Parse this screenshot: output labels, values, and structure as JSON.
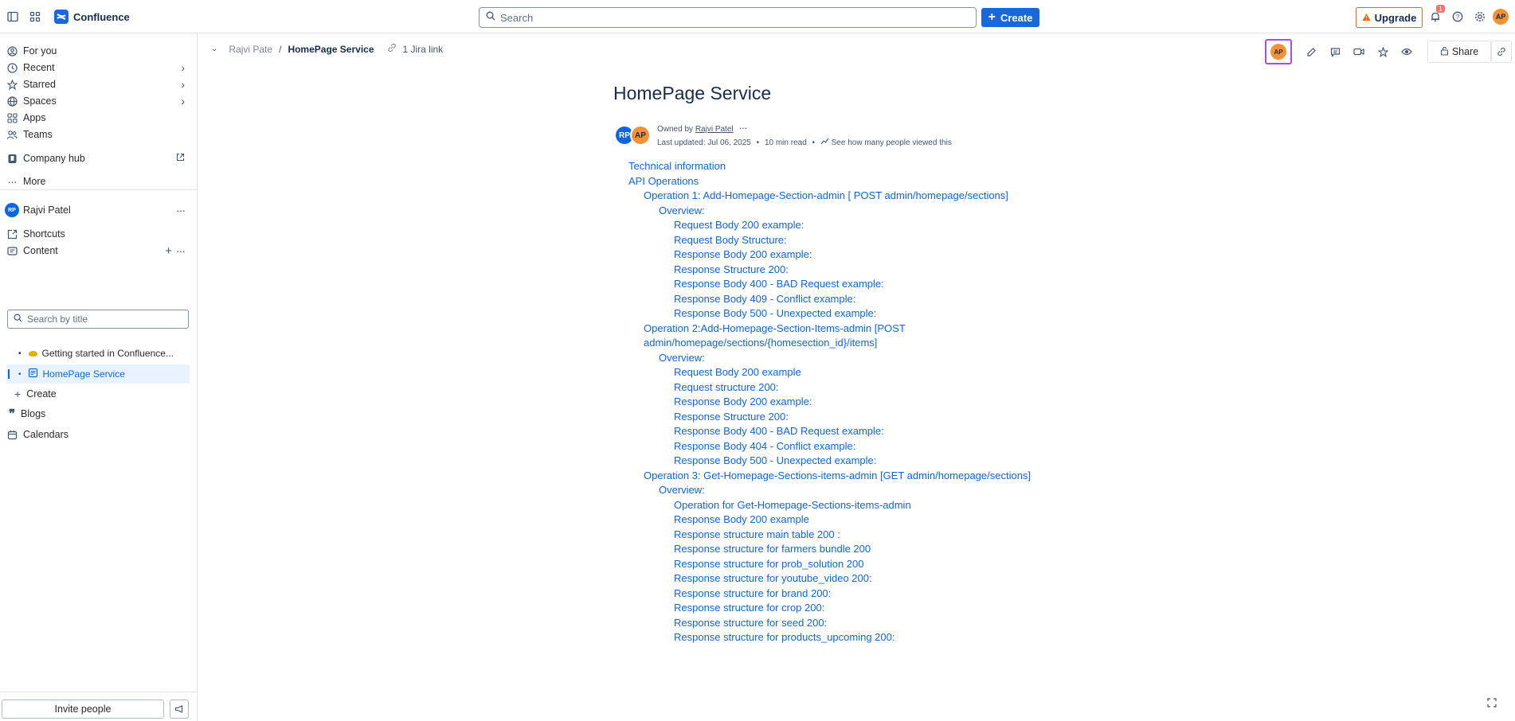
{
  "topbar": {
    "app_name": "Confluence",
    "search_placeholder": "Search",
    "create_label": "Create",
    "upgrade_label": "Upgrade",
    "notification_count": "1",
    "user_initials": "AP"
  },
  "sidebar": {
    "nav": [
      {
        "label": "For you",
        "icon": "person-circle-icon"
      },
      {
        "label": "Recent",
        "icon": "clock-icon"
      },
      {
        "label": "Starred",
        "icon": "star-icon"
      },
      {
        "label": "Spaces",
        "icon": "globe-icon"
      },
      {
        "label": "Apps",
        "icon": "apps-icon"
      },
      {
        "label": "Teams",
        "icon": "people-icon"
      }
    ],
    "company_hub": "Company hub",
    "more": "More",
    "space_initials": "RP",
    "space_name": "Rajvi Patel",
    "shortcuts": "Shortcuts",
    "content": "Content",
    "search_placeholder": "Search by title",
    "tree": [
      {
        "label": "Getting started in Confluence..."
      },
      {
        "label": "HomePage Service"
      }
    ],
    "create": "Create",
    "blogs": "Blogs",
    "calendars": "Calendars",
    "invite": "Invite people"
  },
  "breadcrumb": {
    "parent": "Rajvi Pate",
    "separator": "/",
    "current": "HomePage Service",
    "jira_link": "1 Jira link"
  },
  "page_actions": {
    "avatar_initials": "AP",
    "share_label": "Share"
  },
  "page": {
    "title": "HomePage Service",
    "author_initials_1": "RP",
    "author_initials_2": "AP",
    "owned_by_prefix": "Owned by",
    "owner": "Rajvi Patel",
    "last_updated": "Last updated: Jul 06, 2025",
    "read_time": "10 min read",
    "views_link": "See how many people viewed this",
    "dot": "•"
  },
  "toc": [
    {
      "level": 1,
      "text": "Technical information"
    },
    {
      "level": 1,
      "text": "API Operations"
    },
    {
      "level": 2,
      "text": "Operation 1: Add-Homepage-Section-admin [ POST admin/homepage/sections]"
    },
    {
      "level": 3,
      "text": "Overview:"
    },
    {
      "level": 4,
      "text": "Request Body 200 example:"
    },
    {
      "level": 4,
      "text": "Request Body Structure:"
    },
    {
      "level": 4,
      "text": "Response Body 200 example:"
    },
    {
      "level": 4,
      "text": "Response Structure 200:"
    },
    {
      "level": 4,
      "text": "Response Body 400 - BAD Request example:"
    },
    {
      "level": 4,
      "text": "Response Body 409 - Conflict example:"
    },
    {
      "level": 4,
      "text": "Response Body 500 - Unexpected example:"
    },
    {
      "level": 2,
      "text": "Operation 2:Add-Homepage-Section-Items-admin [POST admin/homepage/sections/{homesection_id}/items]"
    },
    {
      "level": 3,
      "text": "Overview:"
    },
    {
      "level": 4,
      "text": "Request Body 200 example"
    },
    {
      "level": 4,
      "text": "Request structure  200:"
    },
    {
      "level": 4,
      "text": "Response Body 200 example:"
    },
    {
      "level": 4,
      "text": "Response Structure 200:"
    },
    {
      "level": 4,
      "text": "Response Body 400 - BAD Request example:"
    },
    {
      "level": 4,
      "text": "Response Body 404 - Conflict example:"
    },
    {
      "level": 4,
      "text": "Response Body 500 - Unexpected example:"
    },
    {
      "level": 2,
      "text": "Operation 3: Get-Homepage-Sections-items-admin [GET admin/homepage/sections]"
    },
    {
      "level": 3,
      "text": "Overview:"
    },
    {
      "level": 4,
      "text": "Operation for Get-Homepage-Sections-items-admin"
    },
    {
      "level": 4,
      "text": "Response Body 200 example"
    },
    {
      "level": 4,
      "text": "Response structure main table  200 :"
    },
    {
      "level": 4,
      "text": "Response structure for farmers bundle   200"
    },
    {
      "level": 4,
      "text": "Response structure for prob_solution   200"
    },
    {
      "level": 4,
      "text": "Response structure for youtube_video 200:"
    },
    {
      "level": 4,
      "text": "Response structure for brand  200:"
    },
    {
      "level": 4,
      "text": "Response structure for crop 200:"
    },
    {
      "level": 4,
      "text": "Response structure for seed 200:"
    },
    {
      "level": 4,
      "text": "Response structure for products_upcoming  200:"
    }
  ],
  "colors": {
    "brand": "#1868db",
    "link": "#0c66e4",
    "upgrade_border": "#e56910",
    "highlight": "#a54de6"
  }
}
